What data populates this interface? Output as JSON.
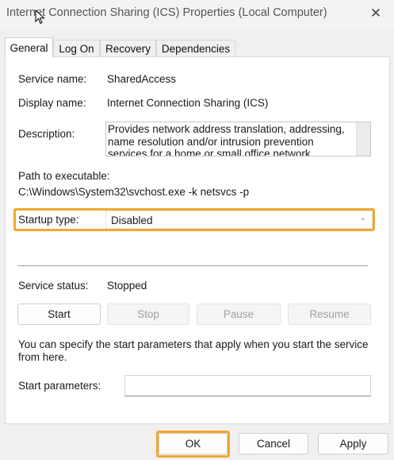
{
  "window": {
    "title": "Internet Connection Sharing (ICS) Properties (Local Computer)",
    "close_glyph": "✕"
  },
  "tabs": [
    {
      "label": "General",
      "active": true
    },
    {
      "label": "Log On",
      "active": false
    },
    {
      "label": "Recovery",
      "active": false
    },
    {
      "label": "Dependencies",
      "active": false
    }
  ],
  "general": {
    "service_name_label": "Service name:",
    "service_name": "SharedAccess",
    "display_name_label": "Display name:",
    "display_name": "Internet Connection Sharing (ICS)",
    "description_label": "Description:",
    "description": "Provides network address translation, addressing, name resolution and/or intrusion prevention services for a home or small office network.",
    "path_label": "Path to executable:",
    "path": "C:\\Windows\\System32\\svchost.exe -k netsvcs -p",
    "startup_label": "Startup type:",
    "startup_value": "Disabled",
    "status_label": "Service status:",
    "status_value": "Stopped",
    "buttons": {
      "start": "Start",
      "stop": "Stop",
      "pause": "Pause",
      "resume": "Resume"
    },
    "hint": "You can specify the start parameters that apply when you start the service from here.",
    "params_label": "Start parameters:",
    "params_value": ""
  },
  "footer": {
    "ok": "OK",
    "cancel": "Cancel",
    "apply": "Apply"
  },
  "colors": {
    "highlight": "#f0a830"
  },
  "icons": {
    "close": "close-icon",
    "dropdown": "chevron-down-icon",
    "cursor": "mouse-cursor-icon"
  }
}
